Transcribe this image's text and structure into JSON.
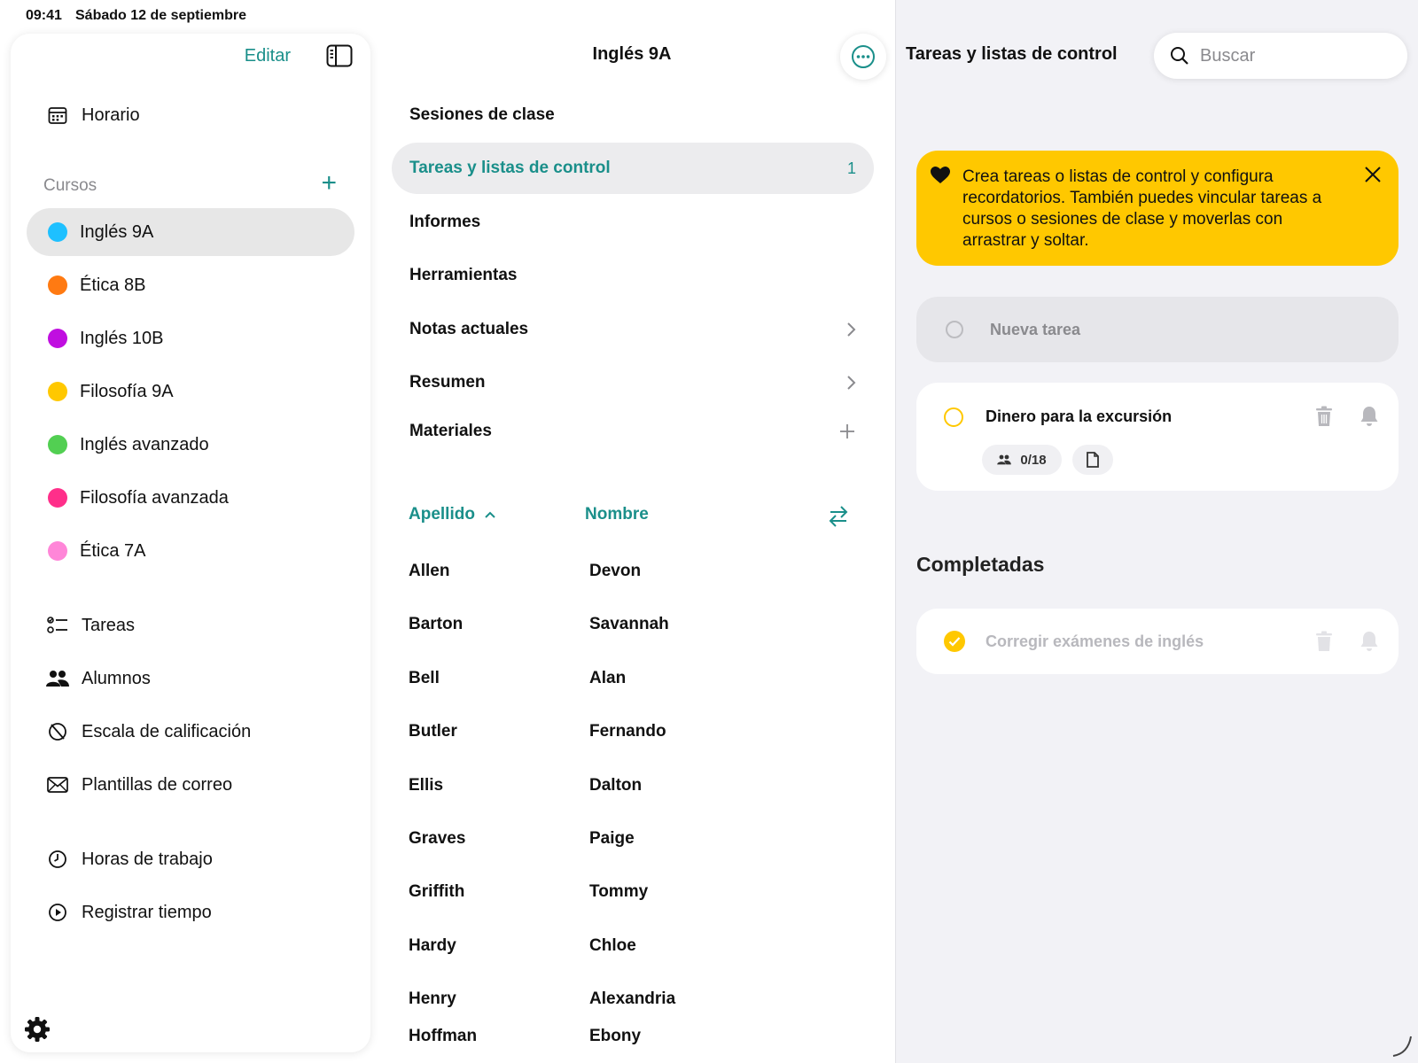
{
  "status": {
    "time": "09:41",
    "date": "Sábado 12 de septiembre"
  },
  "sidebar": {
    "edit_label": "Editar",
    "schedule_label": "Horario",
    "courses_label": "Cursos",
    "courses": [
      {
        "label": "Inglés 9A",
        "color": "#1ec0ff",
        "selected": true
      },
      {
        "label": "Ética 8B",
        "color": "#ff7a12"
      },
      {
        "label": "Inglés 10B",
        "color": "#c00ee0"
      },
      {
        "label": "Filosofía 9A",
        "color": "#ffc800"
      },
      {
        "label": "Inglés avanzado",
        "color": "#52cf52"
      },
      {
        "label": "Filosofía avanzada",
        "color": "#ff2f8a"
      },
      {
        "label": "Ética 7A",
        "color": "#ff86d8"
      }
    ],
    "tools": [
      {
        "label": "Tareas",
        "icon": "checklist-icon"
      },
      {
        "label": "Alumnos",
        "icon": "people-icon"
      },
      {
        "label": "Escala de calificación",
        "icon": "grading-scale-icon"
      },
      {
        "label": "Plantillas de correo",
        "icon": "envelope-icon"
      }
    ],
    "time_items": [
      {
        "label": "Horas de trabajo",
        "icon": "clock-icon"
      },
      {
        "label": "Registrar tiempo",
        "icon": "play-circle-icon"
      }
    ]
  },
  "middle": {
    "title": "Inglés 9A",
    "menu": [
      {
        "label": "Sesiones de clase"
      },
      {
        "label": "Tareas y listas de control",
        "count": "1",
        "selected": true
      },
      {
        "label": "Informes"
      },
      {
        "label": "Herramientas"
      },
      {
        "label": "Notas actuales",
        "chevron": true
      },
      {
        "label": "Resumen",
        "chevron": true
      },
      {
        "label": "Materiales",
        "add": true
      }
    ],
    "sort": {
      "last_name": "Apellido",
      "first_name": "Nombre"
    },
    "students": [
      {
        "last": "Allen",
        "first": "Devon"
      },
      {
        "last": "Barton",
        "first": "Savannah"
      },
      {
        "last": "Bell",
        "first": "Alan"
      },
      {
        "last": "Butler",
        "first": "Fernando"
      },
      {
        "last": "Ellis",
        "first": "Dalton"
      },
      {
        "last": "Graves",
        "first": "Paige"
      },
      {
        "last": "Griffith",
        "first": "Tommy"
      },
      {
        "last": "Hardy",
        "first": "Chloe"
      },
      {
        "last": "Henry",
        "first": "Alexandria"
      },
      {
        "last": "Hoffman",
        "first": "Ebony"
      }
    ]
  },
  "right": {
    "title": "Tareas y listas de control",
    "search_placeholder": "Buscar",
    "tip": "Crea tareas o listas de control y configura recordatorios. También puedes vincular tareas a cursos o sesiones de clase y moverlas con arrastrar y soltar.",
    "new_task_placeholder": "Nueva tarea",
    "tasks": [
      {
        "title": "Dinero para la excursión",
        "students_count": "0/18"
      }
    ],
    "completed_heading": "Completadas",
    "completed": [
      {
        "title": "Corregir exámenes de inglés"
      }
    ],
    "colors": {
      "accent": "#1a8f8a",
      "highlight": "#ffc800"
    }
  }
}
